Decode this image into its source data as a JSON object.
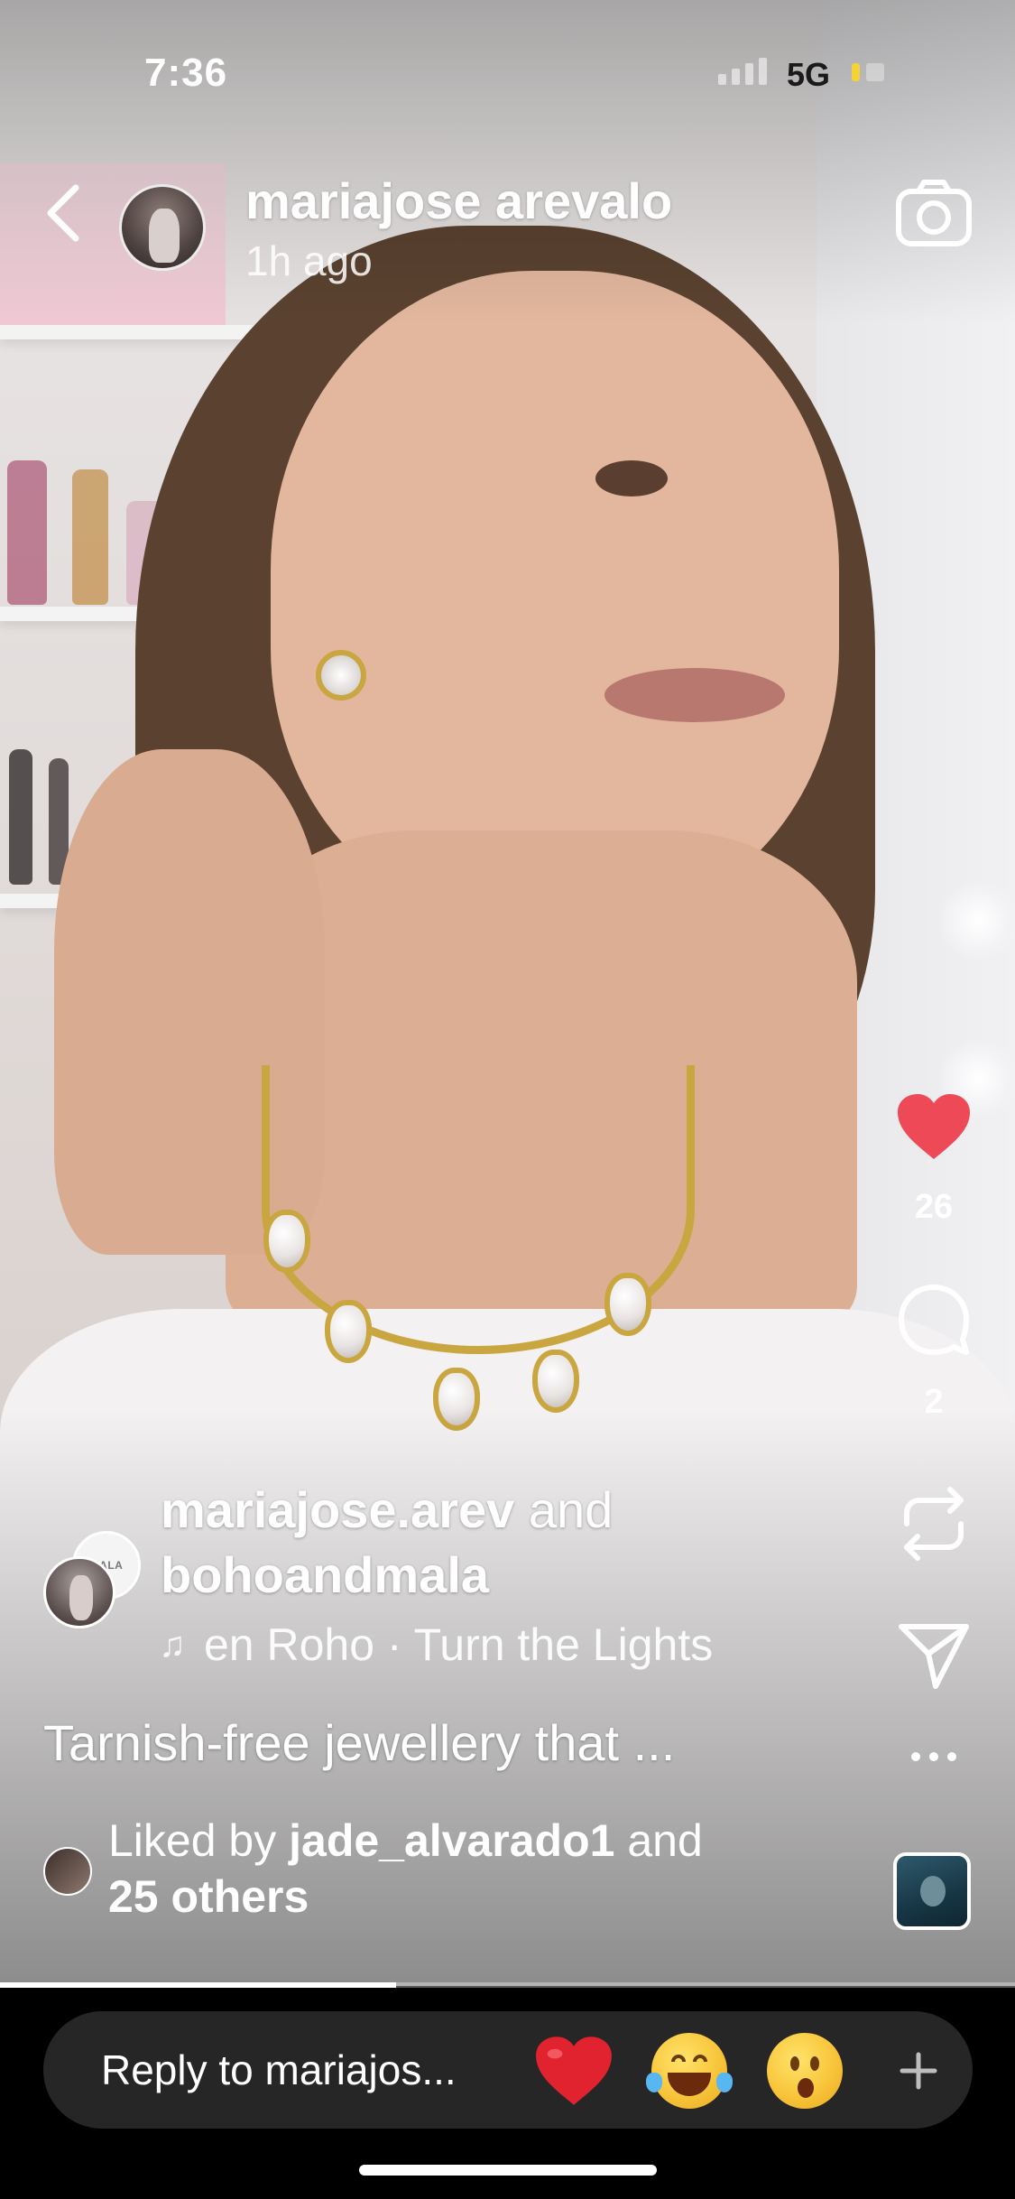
{
  "status_bar": {
    "time": "7:36",
    "network": "5G"
  },
  "header": {
    "username": "mariajose arevalo",
    "timestamp": "1h ago"
  },
  "actions": {
    "like_count": "26",
    "comment_count": "2"
  },
  "post": {
    "collab_user": "mariajose.arev",
    "collab_joiner": " and",
    "collab_partner": "bohoandmala",
    "brand_avatar_text": "MALA",
    "music": "en Roho · Turn the Lights",
    "caption": "Tarnish-free jewellery that ..."
  },
  "likes": {
    "prefix": "Liked by ",
    "user": "jade_alvarado1",
    "joiner": " and",
    "others": "25 others"
  },
  "progress": {
    "fraction": 0.39
  },
  "reply": {
    "placeholder": "Reply to mariajos...",
    "reactions": [
      "❤️",
      "😂",
      "😮"
    ]
  },
  "colors": {
    "like_red": "#ed4956",
    "battery_yellow": "#f4d23a",
    "necklace_gold": "#c9a640"
  },
  "icons": [
    "chevron-left-icon",
    "camera-icon",
    "heart-icon",
    "comment-icon",
    "repost-icon",
    "send-icon",
    "more-icon",
    "music-note-icon",
    "plus-icon"
  ]
}
